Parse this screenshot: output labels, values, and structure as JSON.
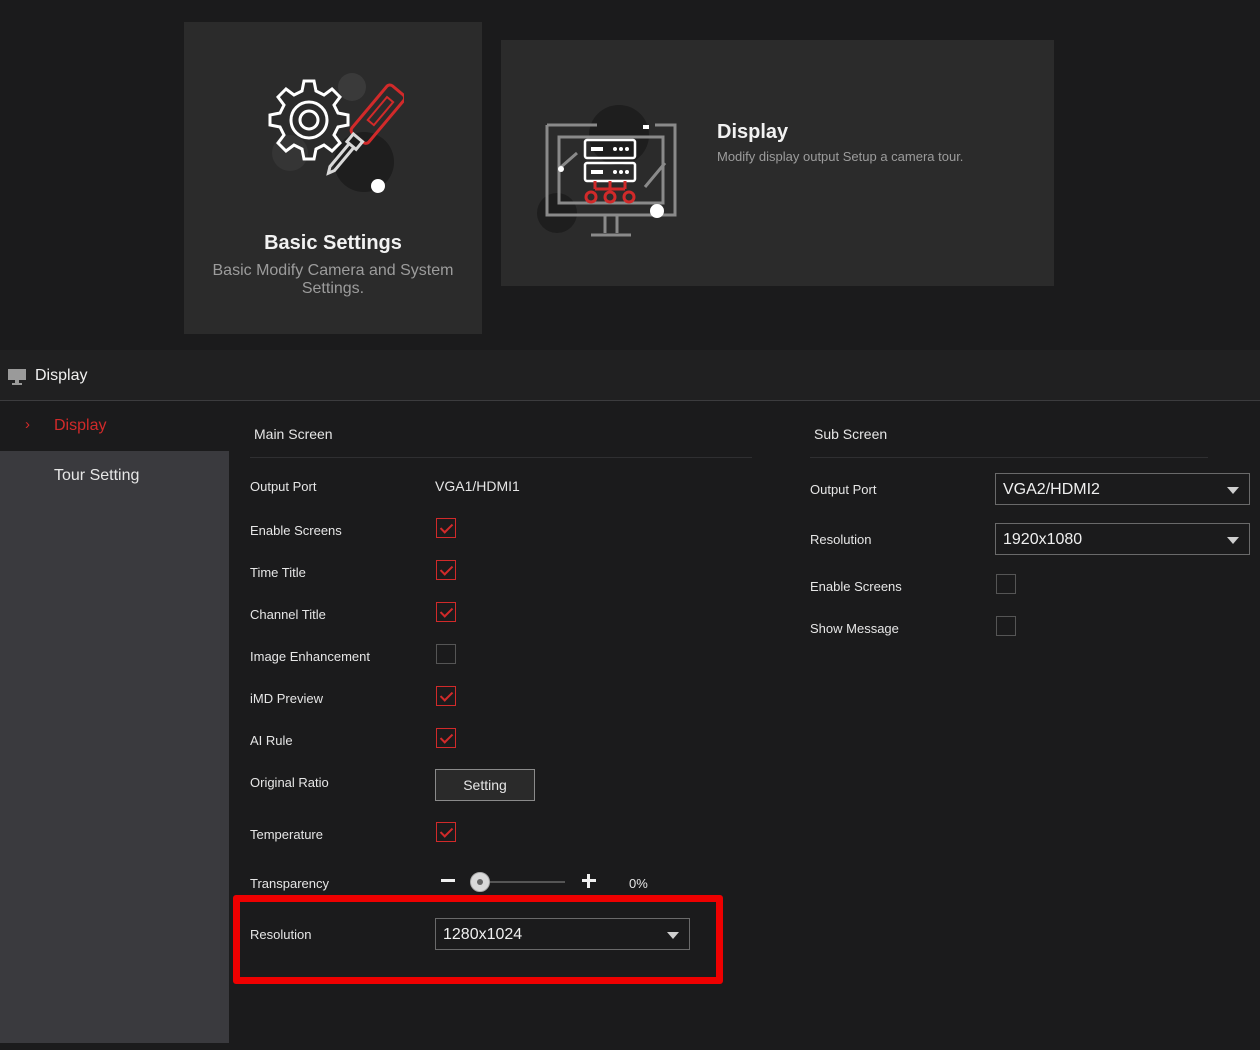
{
  "cards": {
    "basic": {
      "title": "Basic Settings",
      "description": "Basic Modify Camera and System Settings."
    },
    "display": {
      "title": "Display",
      "description": "Modify display output Setup a camera tour."
    }
  },
  "header": {
    "title": "Display",
    "icon": "monitor-icon"
  },
  "sidebar": {
    "items": [
      {
        "label": "Display",
        "active": true
      },
      {
        "label": "Tour Setting",
        "active": false
      }
    ]
  },
  "main_screen": {
    "title": "Main Screen",
    "output_port": {
      "label": "Output Port",
      "value": "VGA1/HDMI1"
    },
    "enable_screens": {
      "label": "Enable Screens",
      "checked": true
    },
    "time_title": {
      "label": "Time Title",
      "checked": true
    },
    "channel_title": {
      "label": "Channel Title",
      "checked": true
    },
    "image_enhancement": {
      "label": "Image Enhancement",
      "checked": false
    },
    "imd_preview": {
      "label": "iMD Preview",
      "checked": true
    },
    "ai_rule": {
      "label": "AI Rule",
      "checked": true
    },
    "original_ratio": {
      "label": "Original Ratio",
      "button": "Setting"
    },
    "temperature": {
      "label": "Temperature",
      "checked": true
    },
    "transparency": {
      "label": "Transparency",
      "value_text": "0%",
      "value": 0
    },
    "resolution": {
      "label": "Resolution",
      "value": "1280x1024"
    }
  },
  "sub_screen": {
    "title": "Sub Screen",
    "output_port": {
      "label": "Output Port",
      "value": "VGA2/HDMI2"
    },
    "resolution": {
      "label": "Resolution",
      "value": "1920x1080"
    },
    "enable_screens": {
      "label": "Enable Screens",
      "checked": false
    },
    "show_message": {
      "label": "Show Message",
      "checked": false
    }
  },
  "colors": {
    "accent": "#d12a2a",
    "highlight": "#ee0000",
    "sidebar": "#3a3a3e",
    "background": "#1b1b1c"
  }
}
